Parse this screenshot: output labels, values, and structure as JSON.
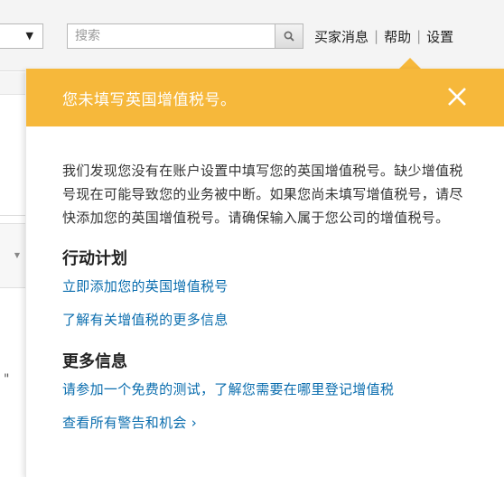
{
  "header": {
    "dropdown_arrow": "▼",
    "search": {
      "placeholder": "搜索",
      "icon": "search-icon"
    },
    "nav": {
      "buyer_messages": "买家消息",
      "help": "帮助",
      "settings": "设置",
      "separator": "|"
    }
  },
  "popover": {
    "title": "您未填写英国增值税号。",
    "close_icon": "close-icon",
    "accent_color": "#f6b83b",
    "message": "我们发现您没有在账户设置中填写您的英国增值税号。缺少增值税号现在可能导致您的业务被中断。如果您尚未填写增值税号，请尽快添加您的英国增值税号。请确保输入属于您公司的增值税号。",
    "action_plan": {
      "heading": "行动计划",
      "links": [
        "立即添加您的英国增值税号",
        "了解有关增值税的更多信息"
      ]
    },
    "more_info": {
      "heading": "更多信息",
      "links": [
        "请参加一个免费的测试，了解您需要在哪里登记增值税",
        "查看所有警告和机会 ›"
      ]
    },
    "link_color": "#0a6dae"
  },
  "background": {
    "left_quote": "\""
  }
}
